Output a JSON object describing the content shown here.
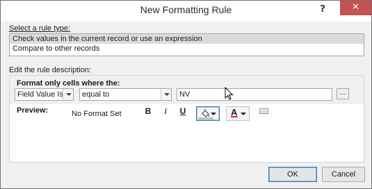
{
  "dialog": {
    "title": "New Formatting Rule",
    "help_glyph": "?",
    "close_glyph": "✕"
  },
  "rule_type": {
    "label": "Select a rule type:",
    "items": [
      {
        "label": "Check values in the current record or use an expression",
        "selected": true
      },
      {
        "label": "Compare to other records",
        "selected": false
      }
    ]
  },
  "description": {
    "label": "Edit the rule description:",
    "format_only_label": "Format only cells where the:",
    "field_select": "Field Value Is",
    "operator_select": "equal to",
    "value_input": "NV",
    "ellipsis_label": "...",
    "preview_label": "Preview:",
    "preview_text": "No Format Set",
    "bold_label": "B",
    "italic_label": "I",
    "underline_label": "U"
  },
  "colors": {
    "fill_bar": "#c0c0c0",
    "font_color_bar": "#e02020",
    "fill_button_border": "#3c7fb1"
  },
  "icons": {
    "fill": "paint-bucket-icon",
    "font_color": "font-color-icon",
    "extra": "border-style-icon"
  },
  "buttons": {
    "ok": "OK",
    "cancel": "Cancel"
  }
}
